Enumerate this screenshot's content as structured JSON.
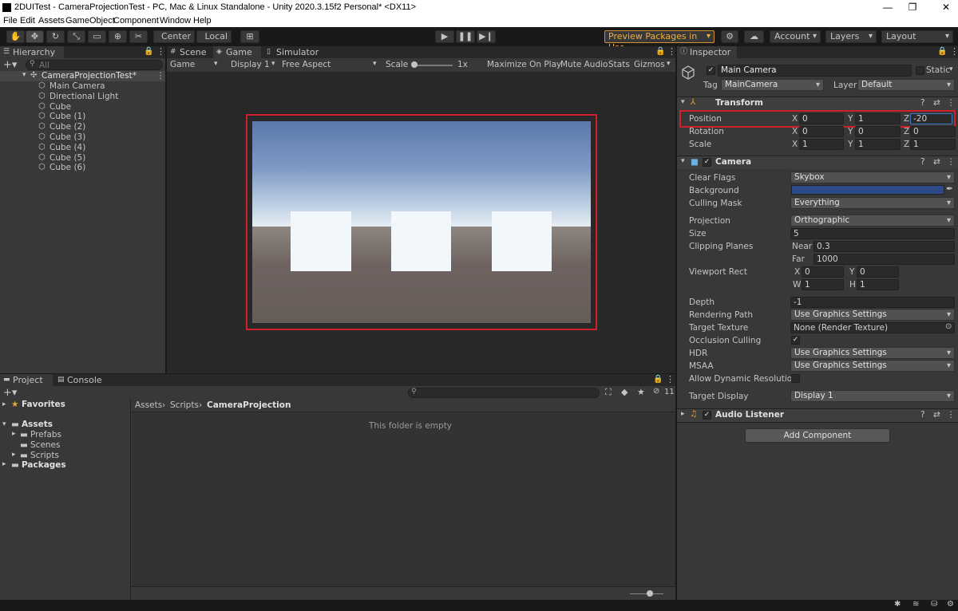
{
  "titlebar": {
    "title": "2DUITest - CameraProjectionTest - PC, Mac & Linux Standalone - Unity 2020.3.15f2 Personal* <DX11>",
    "minimize": "—",
    "restore": "❐",
    "close": "✕"
  },
  "menu": [
    "File",
    "Edit",
    "Assets",
    "GameObject",
    "Component",
    "Window",
    "Help"
  ],
  "toolbar": {
    "center": "Center",
    "local": "Local",
    "preview_packages": "Preview Packages in Use",
    "account": "Account",
    "layers": "Layers",
    "layout": "Layout"
  },
  "hierarchy": {
    "tab": "Hierarchy",
    "search_placeholder": "All",
    "scene": "CameraProjectionTest*",
    "items": [
      "Main Camera",
      "Directional Light",
      "Cube",
      "Cube (1)",
      "Cube (2)",
      "Cube (3)",
      "Cube (4)",
      "Cube (5)",
      "Cube (6)"
    ]
  },
  "game": {
    "tabs": [
      "Scene",
      "Game",
      "Simulator"
    ],
    "game_dropdown": "Game",
    "display": "Display 1",
    "aspect": "Free Aspect",
    "scale_label": "Scale",
    "scale_value": "1x",
    "maximize": "Maximize On Play",
    "mute": "Mute Audio",
    "stats": "Stats",
    "gizmos": "Gizmos"
  },
  "project": {
    "tabs": [
      "Project",
      "Console"
    ],
    "favorites": "Favorites",
    "assets": "Assets",
    "folders": [
      "Prefabs",
      "Scenes",
      "Scripts"
    ],
    "packages": "Packages",
    "breadcrumb": [
      "Assets",
      "Scripts",
      "CameraProjection"
    ],
    "empty": "This folder is empty",
    "hidden_count": "11"
  },
  "inspector": {
    "tab": "Inspector",
    "object_name": "Main Camera",
    "static_label": "Static",
    "tag_label": "Tag",
    "tag_value": "MainCamera",
    "layer_label": "Layer",
    "layer_value": "Default",
    "transform": {
      "title": "Transform",
      "position": {
        "label": "Position",
        "x": "0",
        "y": "1",
        "z": "-20"
      },
      "rotation": {
        "label": "Rotation",
        "x": "0",
        "y": "0",
        "z": "0"
      },
      "scale": {
        "label": "Scale",
        "x": "1",
        "y": "1",
        "z": "1"
      }
    },
    "camera": {
      "title": "Camera",
      "clear_flags_label": "Clear Flags",
      "clear_flags": "Skybox",
      "background_label": "Background",
      "background_color": "#2b4a87",
      "culling_mask_label": "Culling Mask",
      "culling_mask": "Everything",
      "projection_label": "Projection",
      "projection": "Orthographic",
      "size_label": "Size",
      "size": "5",
      "clipping_label": "Clipping Planes",
      "near_label": "Near",
      "near": "0.3",
      "far_label": "Far",
      "far": "1000",
      "viewport_label": "Viewport Rect",
      "vx": "0",
      "vy": "0",
      "vw": "1",
      "vh": "1",
      "depth_label": "Depth",
      "depth": "-1",
      "rendering_path_label": "Rendering Path",
      "rendering_path": "Use Graphics Settings",
      "target_texture_label": "Target Texture",
      "target_texture": "None (Render Texture)",
      "occlusion_label": "Occlusion Culling",
      "hdr_label": "HDR",
      "hdr": "Use Graphics Settings",
      "msaa_label": "MSAA",
      "msaa": "Use Graphics Settings",
      "dynres_label": "Allow Dynamic Resolution",
      "target_display_label": "Target Display",
      "target_display": "Display 1"
    },
    "audio_listener": "Audio Listener",
    "add_component": "Add Component"
  },
  "colors": {
    "highlight_red": "#d0202a",
    "accent_orange": "#e0a030"
  }
}
